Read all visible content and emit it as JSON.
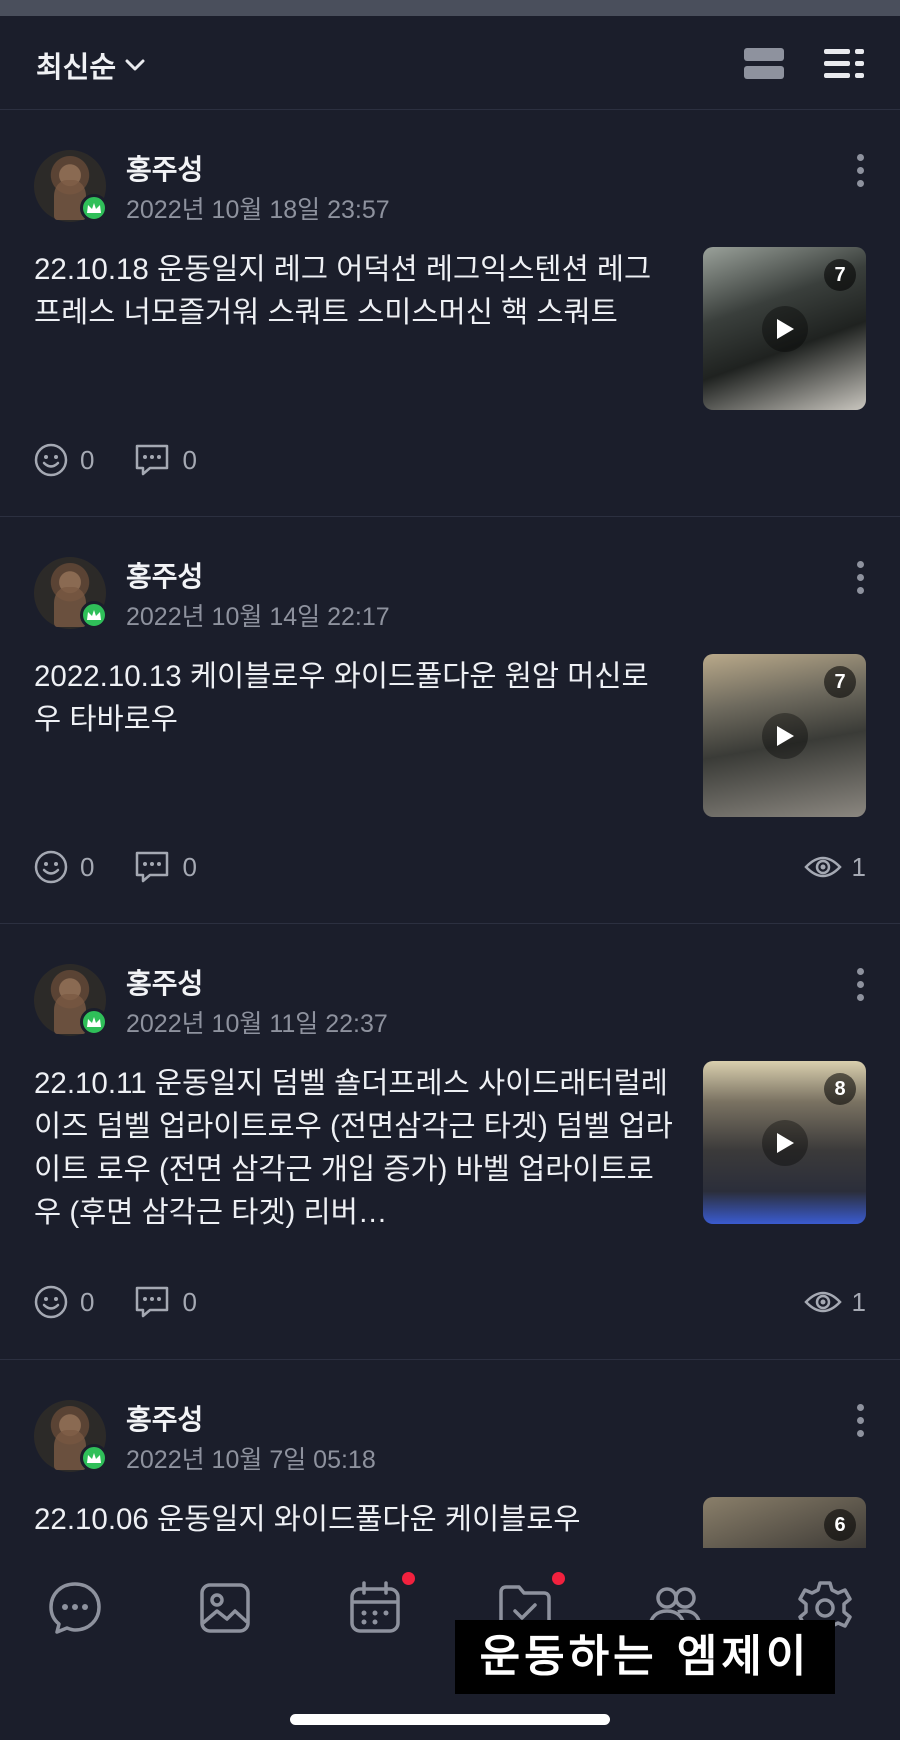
{
  "header": {
    "sort_label": "최신순"
  },
  "posts": [
    {
      "author": "홍주성",
      "date": "2022년 10월 18일 23:57",
      "text": "22.10.18 운동일지 레그 어덕션 레그익스텐션 레그프레스 너모즐거워 스쿼트 스미스머신 핵 스쿼트",
      "media_count": "7",
      "likes": "0",
      "comments": "0",
      "views": ""
    },
    {
      "author": "홍주성",
      "date": "2022년 10월 14일 22:17",
      "text": "2022.10.13 케이블로우 와이드풀다운 원암 머신로우 타바로우",
      "media_count": "7",
      "likes": "0",
      "comments": "0",
      "views": "1"
    },
    {
      "author": "홍주성",
      "date": "2022년 10월 11일 22:37",
      "text": "22.10.11 운동일지 덤벨 숄더프레스 사이드래터럴레이즈 덤벨 업라이트로우 (전면삼각근 타겟) 덤벨 업라이트 로우 (전면 삼각근 개입 증가) 바벨 업라이트로우 (후면 삼각근 타겟) 리버…",
      "media_count": "8",
      "likes": "0",
      "comments": "0",
      "views": "1"
    },
    {
      "author": "홍주성",
      "date": "2022년 10월 7일 05:18",
      "text": "22.10.06 운동일지 와이드풀다운 케이블로우",
      "media_count": "6",
      "likes": "",
      "comments": "",
      "views": ""
    }
  ],
  "tabbar": {
    "items": [
      "chat-icon",
      "gallery-icon",
      "calendar-icon",
      "folder-check-icon",
      "members-icon",
      "settings-icon"
    ],
    "badges": {
      "calendar": true,
      "folder": true
    }
  },
  "watermark": "운동하는 엠제이",
  "colors": {
    "background": "#1b1e2b",
    "divider": "#2c3040",
    "badge_green": "#2fbf59",
    "notification_red": "#f2213e",
    "muted_text": "#8e929e"
  }
}
